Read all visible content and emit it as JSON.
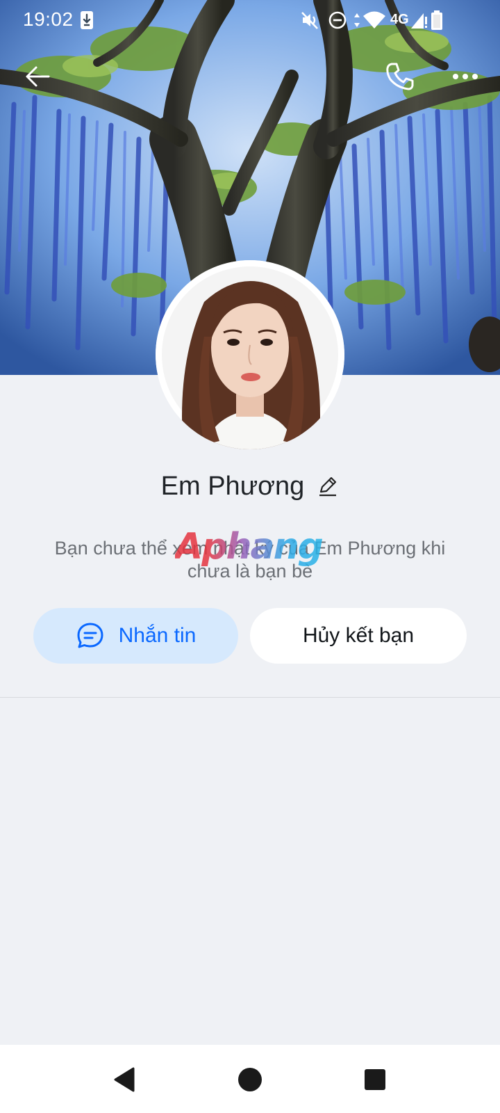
{
  "status_bar": {
    "time": "19:02",
    "network": "4G",
    "icons": [
      "download-notification-icon",
      "mute-icon",
      "do-not-disturb-icon",
      "data-arrows-icon",
      "wifi-icon",
      "cellular-signal-icon",
      "battery-icon"
    ]
  },
  "header": {
    "back_icon": "arrow-left-icon",
    "call_icon": "phone-icon",
    "more_icon": "more-dots-icon"
  },
  "profile": {
    "name": "Em Phương",
    "info_text": "Bạn chưa thể xem nhật ký của Em Phương khi chưa là bạn bè"
  },
  "watermark": "Aphang",
  "actions": {
    "message_label": "Nhắn tin",
    "unfriend_label": "Hủy kết bạn"
  },
  "colors": {
    "accent": "#0a68ff",
    "message_button_bg": "#d6e9fd",
    "page_bg": "#eff1f5"
  },
  "nav_bar": {
    "back": "nav-back-icon",
    "home": "nav-home-icon",
    "recents": "nav-recents-icon"
  }
}
